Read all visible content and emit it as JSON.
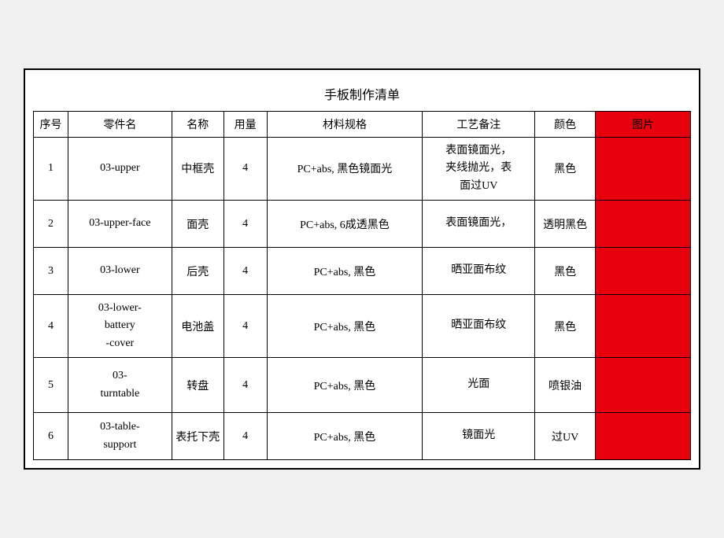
{
  "table": {
    "title": "手板制作清单",
    "headers": [
      "序号",
      "零件名",
      "名称",
      "用量",
      "材料规格",
      "工艺备注",
      "颜色",
      "图片"
    ],
    "rows": [
      {
        "seq": "1",
        "part": "03-upper",
        "name": "中框壳",
        "qty": "4",
        "spec": "PC+abs, 黑色镜面光",
        "process": "表面镜面光，\n夹线抛光，表\n面过UV",
        "color": "黑色",
        "pic": ""
      },
      {
        "seq": "2",
        "part": "03-upper-face",
        "name": "面壳",
        "qty": "4",
        "spec": "PC+abs, 6成透黑色",
        "process": "表面镜面光，",
        "color": "透明黑色",
        "pic": ""
      },
      {
        "seq": "3",
        "part": "03-lower",
        "name": "后壳",
        "qty": "4",
        "spec": "PC+abs, 黑色",
        "process": "晒亚面布纹",
        "color": "黑色",
        "pic": ""
      },
      {
        "seq": "4",
        "part": "03-lower-\nbattery\n-cover",
        "name": "电池盖",
        "qty": "4",
        "spec": "PC+abs, 黑色",
        "process": "晒亚面布纹",
        "color": "黑色",
        "pic": ""
      },
      {
        "seq": "5",
        "part": "03-\nturntable",
        "name": "转盘",
        "qty": "4",
        "spec": "PC+abs, 黑色",
        "process": "光面",
        "color": "喷银油",
        "pic": ""
      },
      {
        "seq": "6",
        "part": "03-table-\nsupport",
        "name": "表托下壳",
        "qty": "4",
        "spec": "PC+abs, 黑色",
        "process": "镜面光",
        "color": "过UV",
        "pic": ""
      }
    ]
  }
}
